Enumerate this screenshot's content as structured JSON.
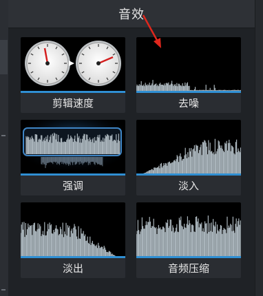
{
  "panel": {
    "title": "音效"
  },
  "effects": [
    {
      "label": "剪辑速度",
      "icon": "speed-clocks-icon"
    },
    {
      "label": "去噪",
      "icon": "denoise-waveform-icon"
    },
    {
      "label": "强调",
      "icon": "emphasis-waveform-icon"
    },
    {
      "label": "淡入",
      "icon": "fade-in-waveform-icon"
    },
    {
      "label": "淡出",
      "icon": "fade-out-waveform-icon"
    },
    {
      "label": "音频压缩",
      "icon": "compressor-waveform-icon"
    }
  ],
  "colors": {
    "accent": "#2f8fd3",
    "waveform": "#a9b4bb",
    "annotation_arrow": "#e0271d"
  }
}
